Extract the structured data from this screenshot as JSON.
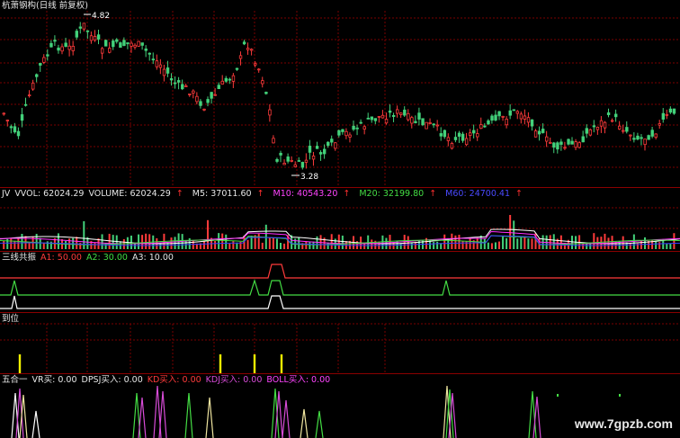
{
  "colors": {
    "up": "#ff3b3b",
    "down": "#43d17a",
    "grid": "#7a0000",
    "separator": "#8a0000",
    "white": "#ffffff",
    "yellow": "#f2f200",
    "magenta": "#ff2cff",
    "blue": "#3a3aff",
    "pink": "#d84cd8",
    "green": "#44dd44",
    "wheat": "#f0e6a0"
  },
  "main": {
    "title": "杭萧钢构(日线 前复权)",
    "high_label": "4.82",
    "low_label": "3.28"
  },
  "volume": {
    "label_name": "JV",
    "label_vvol": "VVOL: 62024.29",
    "label_volume": "VOLUME: 62024.29",
    "label_m5": "M5: 37011.60",
    "label_m10": "M10: 40543.20",
    "label_m20": "M20: 32199.80",
    "label_m60": "M60: 24700.41"
  },
  "resonance": {
    "title": "三线共振",
    "a1": "A1: 50.00",
    "a2": "A2: 30.00",
    "a3": "A3: 10.00"
  },
  "daowei": {
    "title": "到位"
  },
  "wuheyi": {
    "title": "五合一",
    "vr": "VR买: 0.00",
    "dpsj": "DPSJ买入: 0.00",
    "kd": "KD买入: 0.00",
    "kdj": "KDJ买入: 0.00",
    "boll": "BOLL买入: 0.00"
  },
  "watermark": "www.7gpzb.com"
}
